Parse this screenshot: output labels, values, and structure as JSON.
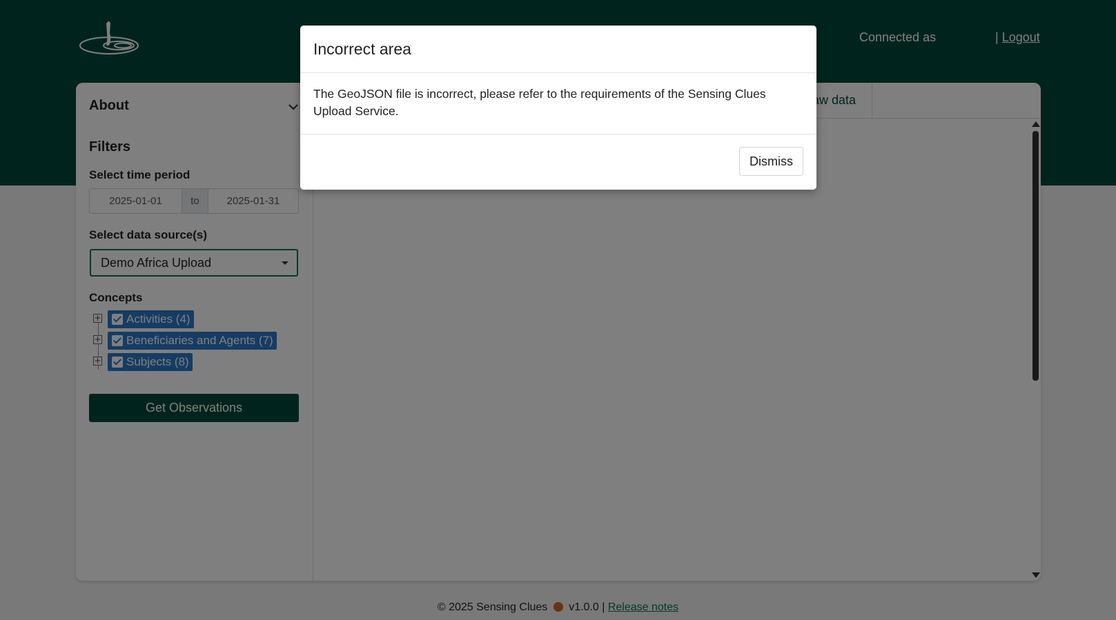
{
  "header": {
    "logo_icon": "sensing-clues-logo-icon",
    "connected_label": "Connected as",
    "separator": "|",
    "logout_label": "Logout"
  },
  "sidebar": {
    "about_title": "About",
    "filters_title": "Filters",
    "time_period_label": "Select time period",
    "date_from": "2025-01-01",
    "date_to_label": "to",
    "date_to": "2025-01-31",
    "data_source_label": "Select data source(s)",
    "data_source_value": "Demo Africa Upload",
    "concepts_label": "Concepts",
    "concepts": [
      {
        "label": "Activities (4)",
        "checked": true
      },
      {
        "label": "Beneficiaries and Agents (7)",
        "checked": true
      },
      {
        "label": "Subjects (8)",
        "checked": true
      }
    ],
    "get_observations_label": "Get Observations"
  },
  "tabs": {
    "raw_data_label": "aw data"
  },
  "footer": {
    "copyright": "© 2025 Sensing Clues",
    "version": "v1.0.0 |",
    "release_notes_label": "Release notes"
  },
  "modal": {
    "title": "Incorrect area",
    "body": "The GeoJSON file is incorrect, please refer to the requirements of the Sensing Clues Upload Service.",
    "dismiss_label": "Dismiss"
  },
  "colors": {
    "brand_dark_green": "#01483a",
    "chip_blue": "#2c78c8",
    "select_border": "#0c6e5a"
  }
}
